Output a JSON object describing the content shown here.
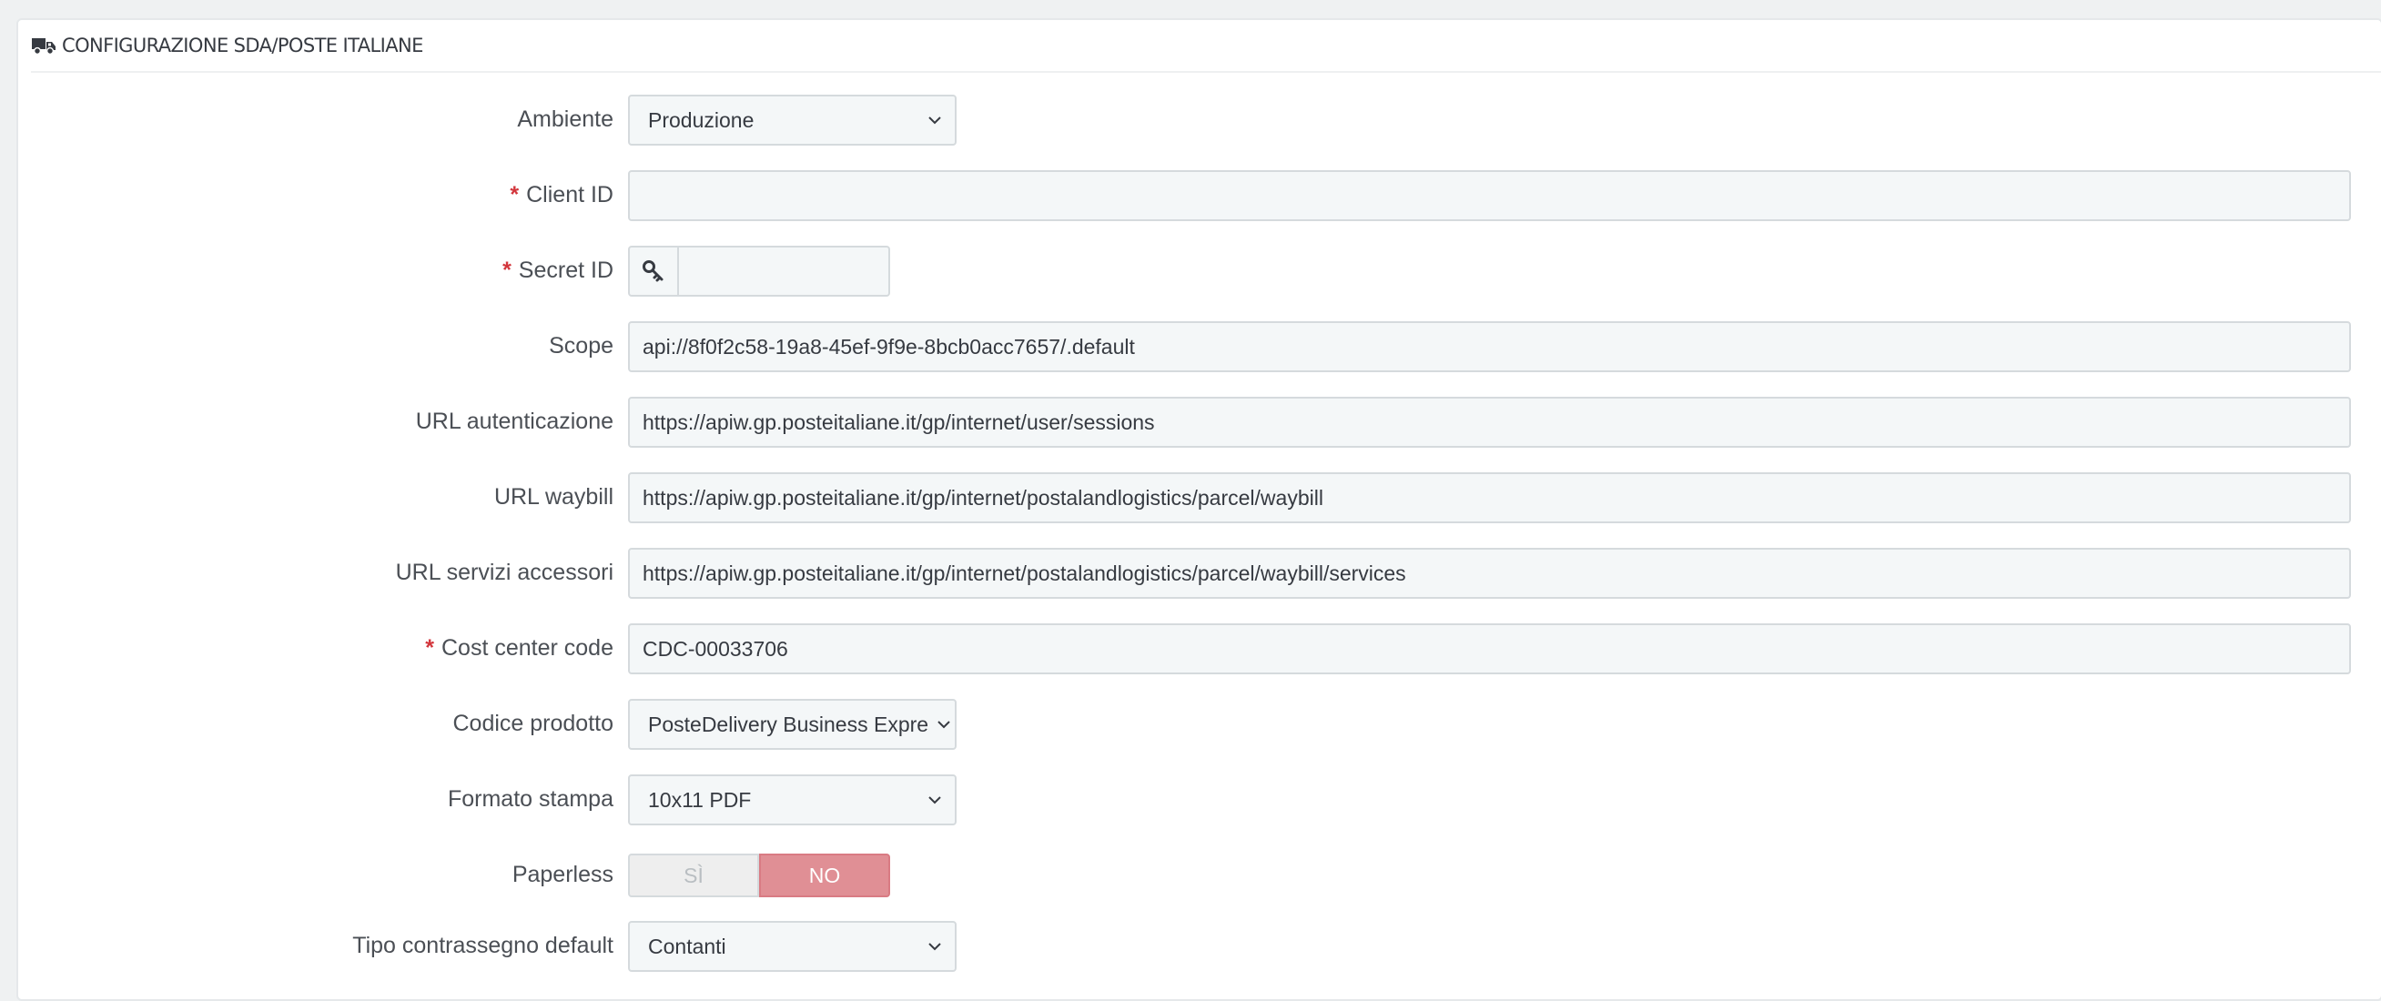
{
  "panel": {
    "title": "CONFIGURAZIONE SDA/POSTE ITALIANE",
    "title_icon": "truck-icon"
  },
  "fields": {
    "ambiente": {
      "label": "Ambiente",
      "value": "Produzione"
    },
    "client_id": {
      "label": "Client ID",
      "value": "",
      "required": true
    },
    "secret_id": {
      "label": "Secret ID",
      "value": "",
      "required": true,
      "addon_icon": "key-icon"
    },
    "scope": {
      "label": "Scope",
      "value": "api://8f0f2c58-19a8-45ef-9f9e-8bcb0acc7657/.default"
    },
    "url_auth": {
      "label": "URL autenticazione",
      "value": "https://apiw.gp.posteitaliane.it/gp/internet/user/sessions"
    },
    "url_waybill": {
      "label": "URL waybill",
      "value": "https://apiw.gp.posteitaliane.it/gp/internet/postalandlogistics/parcel/waybill"
    },
    "url_services": {
      "label": "URL servizi accessori",
      "value": "https://apiw.gp.posteitaliane.it/gp/internet/postalandlogistics/parcel/waybill/services"
    },
    "cost_center": {
      "label": "Cost center code",
      "value": "CDC-00033706",
      "required": true
    },
    "codice_prodotto": {
      "label": "Codice prodotto",
      "value": "PosteDelivery Business Express"
    },
    "formato_stampa": {
      "label": "Formato stampa",
      "value": "10x11 PDF"
    },
    "paperless": {
      "label": "Paperless",
      "yes_label": "SÌ",
      "no_label": "NO",
      "selected": "NO"
    },
    "tipo_contrassegno": {
      "label": "Tipo contrassegno default",
      "value": "Contanti"
    }
  },
  "required_marker": "*",
  "colors": {
    "required": "#d3363c",
    "toggle_no_active": "#e08f95",
    "input_bg": "#f4f7f8"
  }
}
